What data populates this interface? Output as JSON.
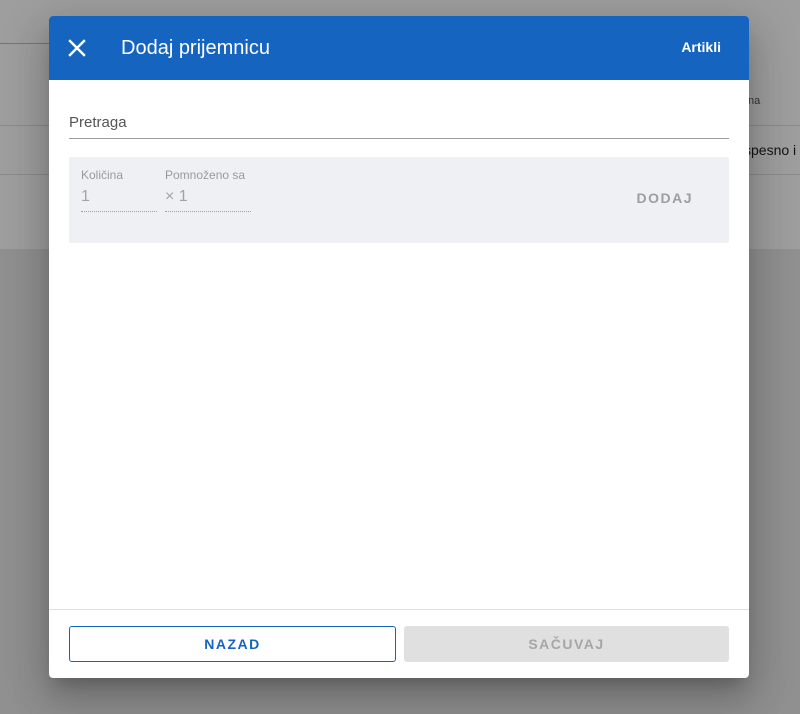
{
  "background": {
    "header_cell_partial": "na",
    "row_cell_partial": "spesno i"
  },
  "dialog": {
    "title": "Dodaj prijemnicu",
    "close_icon": "close-icon",
    "header_action": "Artikli",
    "header_color": "#1565c0",
    "search": {
      "placeholder": "Pretraga",
      "value": ""
    },
    "quantity": {
      "label": "Količina",
      "value": "1"
    },
    "multiplier": {
      "label": "Pomnoženo sa",
      "value": "× 1"
    },
    "add_button": "DODAJ",
    "back_button": "NAZAD",
    "save_button": "SAČUVAJ"
  }
}
